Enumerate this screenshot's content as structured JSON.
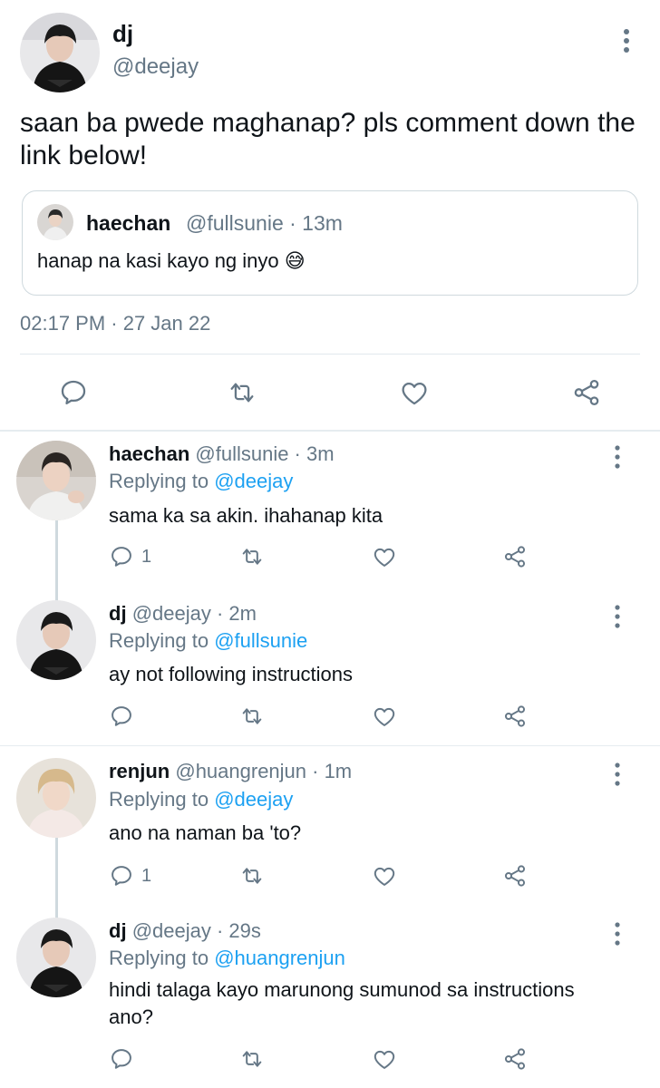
{
  "main_tweet": {
    "name": "dj",
    "handle": "@deejay",
    "text": "saan ba pwede maghanap? pls comment down the link below!",
    "timestamp": "02:17 PM · 27 Jan 22",
    "quote": {
      "name": "haechan",
      "handle": "@fullsunie · 13m",
      "text": "hanap na kasi kayo ng inyo 😅"
    }
  },
  "replies": [
    {
      "name": "haechan",
      "meta": "@fullsunie · 3m",
      "replying_label": "Replying to",
      "replying_to": "@deejay",
      "text": "sama ka sa akin. ihahanap kita",
      "reply_count": "1"
    },
    {
      "name": "dj",
      "meta": "@deejay · 2m",
      "replying_label": "Replying to",
      "replying_to": "@fullsunie",
      "text": "ay not following instructions",
      "reply_count": ""
    },
    {
      "name": "renjun",
      "meta": "@huangrenjun · 1m",
      "replying_label": "Replying to",
      "replying_to": "@deejay",
      "text": "ano na naman ba 'to?",
      "reply_count": "1"
    },
    {
      "name": "dj",
      "meta": "@deejay · 29s",
      "replying_label": "Replying to",
      "replying_to": "@huangrenjun",
      "text": "hindi talaga kayo marunong sumunod sa instructions ano?",
      "reply_count": ""
    }
  ],
  "icons": {
    "reply": "reply-icon",
    "retweet": "retweet-icon",
    "like": "like-icon",
    "share": "share-icon",
    "more": "more-icon"
  },
  "colors": {
    "text": "#0f1419",
    "secondary": "#657786",
    "link": "#1da1f2",
    "border": "#e6ecf0"
  }
}
